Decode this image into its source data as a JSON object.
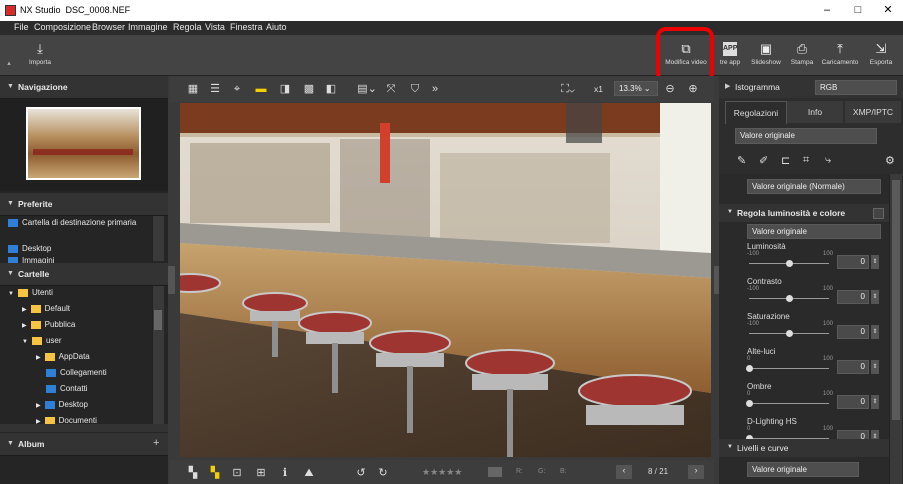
{
  "window": {
    "app_name": "NX Studio",
    "file_name": "DSC_0008.NEF",
    "controls": {
      "minimize": "–",
      "maximize": "□",
      "close": "✕"
    }
  },
  "menu": [
    "File",
    "Composizione",
    "Browser",
    "Immagine",
    "Regola",
    "Vista",
    "Finestra",
    "Aiuto"
  ],
  "toolbar": {
    "import_label": "Importa",
    "modify_video_label": "Modifica video",
    "other_app_label": "tre app",
    "slideshow_label": "Slideshow",
    "print_label": "Stampa",
    "upload_label": "Caricamento",
    "export_label": "Esporta"
  },
  "left_panel": {
    "navigation_title": "Navigazione",
    "favorites_title": "Preferite",
    "favorites": [
      "Cartella di destinazione primaria",
      "Desktop",
      "Immagini"
    ],
    "folders_title": "Cartelle",
    "folders": [
      "Utenti",
      "Default",
      "Pubblica",
      "user",
      "AppData",
      "Collegamenti",
      "Contatti",
      "Desktop",
      "Documenti"
    ],
    "album_title": "Album",
    "album_add": "+"
  },
  "center": {
    "zoom_factor": "x1",
    "zoom_percent": "13.3%",
    "rating_labels": {
      "r": "R:",
      "g": "G:",
      "b": "B:"
    },
    "page_counter": "8 / 21"
  },
  "right_panel": {
    "histogram_label": "Istogramma",
    "histogram_mode": "RGB",
    "tabs": [
      "Regolazioni",
      "Info",
      "XMP/IPTC"
    ],
    "preset": "Valore originale",
    "picture_control": "Valore originale (Normale)",
    "brightness_section": "Regola luminosità e colore",
    "brightness_preset": "Valore originale",
    "sliders": [
      {
        "label": "Luminosità",
        "min": "-100",
        "max": "100",
        "value": "0",
        "position": 0.5
      },
      {
        "label": "Contrasto",
        "min": "-100",
        "max": "100",
        "value": "0",
        "position": 0.5
      },
      {
        "label": "Saturazione",
        "min": "-100",
        "max": "100",
        "value": "0",
        "position": 0.5
      },
      {
        "label": "Alte-luci",
        "min": "0",
        "max": "100",
        "value": "0",
        "position": 0.0
      },
      {
        "label": "Ombre",
        "min": "0",
        "max": "100",
        "value": "0",
        "position": 0.0
      },
      {
        "label": "D-Lighting HS",
        "min": "0",
        "max": "100",
        "value": "0",
        "position": 0.0
      }
    ],
    "levels_section": "Livelli e curve",
    "levels_preset": "Valore originale"
  }
}
